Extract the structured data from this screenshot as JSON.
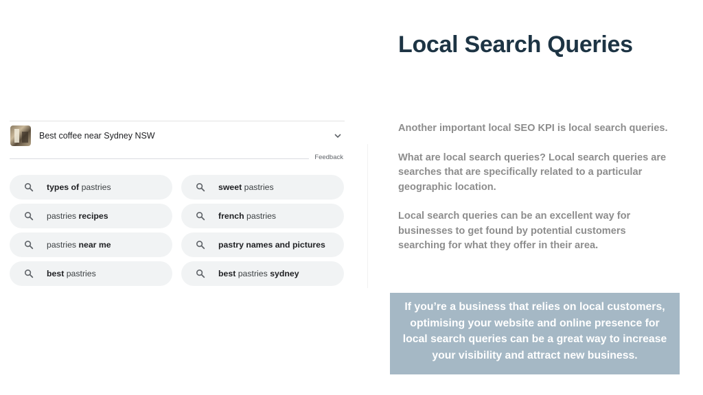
{
  "slide": {
    "title": "Local Search Queries",
    "paragraphs": [
      "Another important local SEO KPI is local search queries.",
      "What are local search queries? Local search queries are searches that are specifically related to a particular geographic location.",
      "Local search queries can be an excellent way for businesses to get found by potential customers searching for what they offer in their area."
    ],
    "callout": "If you’re a business that relies on local customers, optimising your website and online presence for local search queries can be a great way to increase your visibility and attract new business."
  },
  "search": {
    "result_text": "Best coffee near Sydney NSW",
    "feedback_label": "Feedback",
    "related_searches": [
      {
        "parts": [
          {
            "text": "types of",
            "bold": true
          },
          {
            "text": " pastries",
            "bold": false
          }
        ]
      },
      {
        "parts": [
          {
            "text": "sweet",
            "bold": true
          },
          {
            "text": " pastries",
            "bold": false
          }
        ]
      },
      {
        "parts": [
          {
            "text": "pastries ",
            "bold": false
          },
          {
            "text": "recipes",
            "bold": true
          }
        ]
      },
      {
        "parts": [
          {
            "text": "french",
            "bold": true
          },
          {
            "text": " pastries",
            "bold": false
          }
        ]
      },
      {
        "parts": [
          {
            "text": "pastries ",
            "bold": false
          },
          {
            "text": "near me",
            "bold": true
          }
        ]
      },
      {
        "parts": [
          {
            "text": "pastry names and pictures",
            "bold": true
          }
        ]
      },
      {
        "parts": [
          {
            "text": "best",
            "bold": true
          },
          {
            "text": " pastries",
            "bold": false
          }
        ]
      },
      {
        "parts": [
          {
            "text": "best",
            "bold": true
          },
          {
            "text": " pastries ",
            "bold": false
          },
          {
            "text": "sydney",
            "bold": true
          }
        ]
      }
    ]
  },
  "icons": {
    "chip_icon": "search-icon",
    "expand_icon": "chevron-down-icon"
  },
  "colors": {
    "title": "#1d3444",
    "body_text": "#8d8d8d",
    "callout_bg": "#a5b8c5",
    "chip_bg": "#f1f3f4"
  }
}
